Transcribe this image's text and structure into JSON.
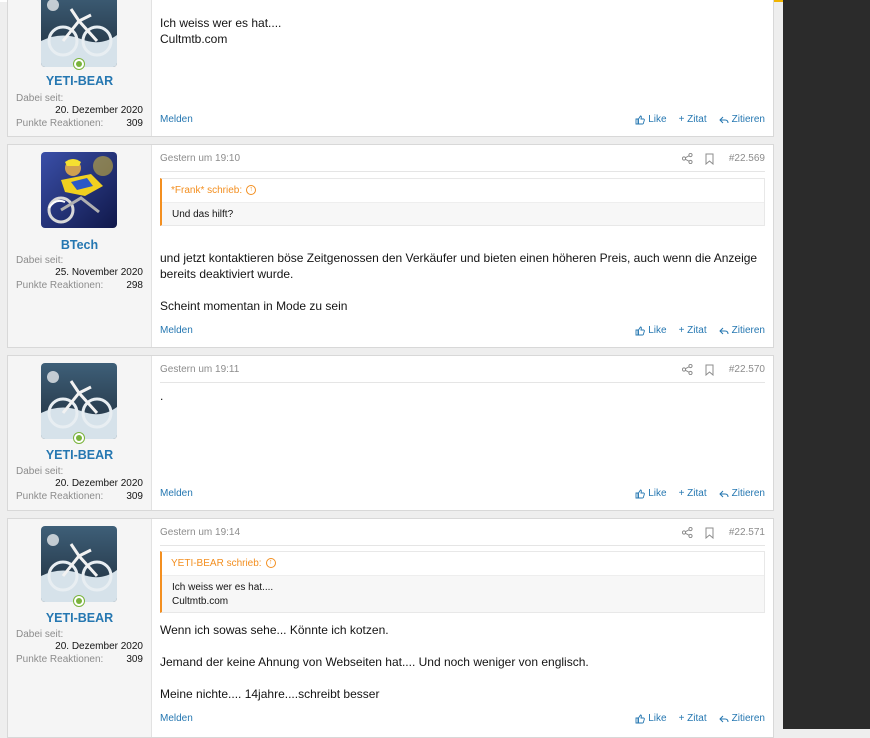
{
  "colors": {
    "accent": "#2577b1",
    "quote_border": "#f38f20",
    "online": "#7ab33c",
    "dark_panel": "#2b2b2b"
  },
  "labels": {
    "member_since": "Dabei seit:",
    "reaction_points": "Punkte Reaktionen:",
    "report": "Melden",
    "like": "Like",
    "quote_plus": "+ Zitat",
    "quote": "Zitieren"
  },
  "posts": [
    {
      "username": "YETI-BEAR",
      "avatar": "snowy-bicycle-avatar",
      "online": true,
      "joined": "20. Dezember 2020",
      "reactions": "309",
      "date": "",
      "number": "",
      "message": [
        "Ich weiss wer es hat....",
        "Cultmtb.com"
      ]
    },
    {
      "username": "BTech",
      "avatar": "bmx-rider-avatar",
      "online": false,
      "joined": "25. November 2020",
      "reactions": "298",
      "date": "Gestern um 19:10",
      "number": "#22.569",
      "quote": {
        "author": "*Frank* schrieb:",
        "lines": [
          "Und das hilft?"
        ]
      },
      "message": [
        "und jetzt kontaktieren böse Zeitgenossen den Verkäufer und bieten einen höheren Preis, auch wenn die Anzeige bereits deaktiviert wurde.",
        "Scheint momentan in Mode zu sein"
      ]
    },
    {
      "username": "YETI-BEAR",
      "avatar": "snowy-bicycle-avatar",
      "online": true,
      "joined": "20. Dezember 2020",
      "reactions": "309",
      "date": "Gestern um 19:11",
      "number": "#22.570",
      "message": [
        "."
      ]
    },
    {
      "username": "YETI-BEAR",
      "avatar": "snowy-bicycle-avatar",
      "online": true,
      "joined": "20. Dezember 2020",
      "reactions": "309",
      "date": "Gestern um 19:14",
      "number": "#22.571",
      "quote": {
        "author": "YETI-BEAR schrieb:",
        "lines": [
          "Ich weiss wer es hat....",
          "Cultmtb.com"
        ]
      },
      "message": [
        "Wenn ich sowas sehe... Könnte ich kotzen.",
        "Jemand der keine Ahnung von Webseiten hat.... Und noch weniger von englisch.",
        "Meine nichte.... 14jahre....schreibt besser"
      ]
    }
  ]
}
